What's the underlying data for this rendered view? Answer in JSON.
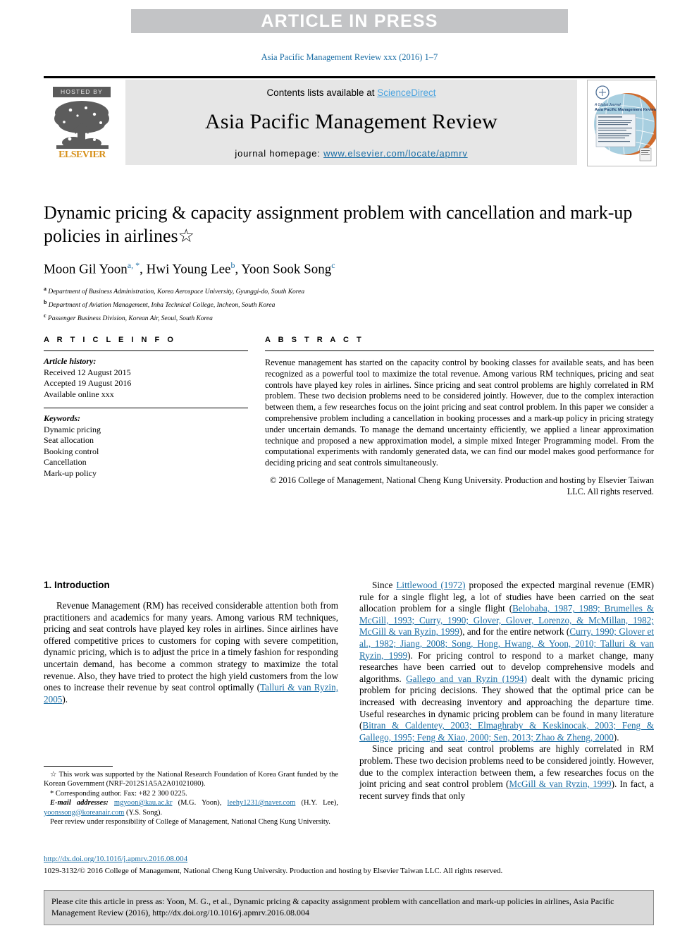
{
  "banner": {
    "text": "ARTICLE IN PRESS"
  },
  "running_head": "Asia Pacific Management Review xxx (2016) 1–7",
  "masthead": {
    "hosted_by": "HOSTED BY",
    "publisher": "ELSEVIER",
    "contents_prefix": "Contents lists available at ",
    "contents_link": "ScienceDirect",
    "journal_title": "Asia Pacific Management Review",
    "homepage_label": "journal homepage: ",
    "homepage_url": "www.elsevier.com/locate/apmrv",
    "cover_line1": "A Global Journal",
    "cover_line2": "Asia Pacific Management Review"
  },
  "article": {
    "title": "Dynamic pricing & capacity assignment problem with cancellation and mark-up policies in airlines☆",
    "authors": "Moon Gil Yoon a,*, Hwi Young Lee b, Yoon Sook Song c",
    "affiliations": [
      "a Department of Business Administration, Korea Aerospace University, Gyunggi-do, South Korea",
      "b Department of Aviation Management, Inha Technical College, Incheon, South Korea",
      "c Passenger Business Division, Korean Air, Seoul, South Korea"
    ]
  },
  "article_info": {
    "heading": "A R T I C L E   I N F O",
    "history_label": "Article history:",
    "history": [
      "Received 12 August 2015",
      "Accepted 19 August 2016",
      "Available online xxx"
    ],
    "keywords_label": "Keywords:",
    "keywords": [
      "Dynamic pricing",
      "Seat allocation",
      "Booking control",
      "Cancellation",
      "Mark-up policy"
    ]
  },
  "abstract": {
    "heading": "A B S T R A C T",
    "text": "Revenue management has started on the capacity control by booking classes for available seats, and has been recognized as a powerful tool to maximize the total revenue. Among various RM techniques, pricing and seat controls have played key roles in airlines. Since pricing and seat control problems are highly correlated in RM problem. These two decision problems need to be considered jointly. However, due to the complex interaction between them, a few researches focus on the joint pricing and seat control problem. In this paper we consider a comprehensive problem including a cancellation in booking processes and a mark-up policy in pricing strategy under uncertain demands. To manage the demand uncertainty efficiently, we applied a linear approximation technique and proposed a new approximation model, a simple mixed Integer Programming model. From the computational experiments with randomly generated data, we can find our model makes good performance for deciding pricing and seat controls simultaneously.",
    "copyright": "© 2016 College of Management, National Cheng Kung University. Production and hosting by Elsevier Taiwan LLC. All rights reserved."
  },
  "introduction": {
    "heading": "1. Introduction",
    "left_paragraph": "Revenue Management (RM) has received considerable attention both from practitioners and academics for many years. Among various RM techniques, pricing and seat controls have played key roles in airlines. Since airlines have offered competitive prices to customers for coping with severe competition, dynamic pricing, which is to adjust the price in a timely fashion for responding uncertain demand, has become a common strategy to maximize the total revenue. Also, they have tried to protect the high yield customers from the low ones to increase their revenue by seat control optimally (",
    "left_ref": "Talluri & van Ryzin, 2005",
    "left_tail": ").",
    "right_p1_a": "Since ",
    "right_p1_ref1": "Littlewood (1972)",
    "right_p1_b": " proposed the expected marginal revenue (EMR) rule for a single flight leg, a lot of studies have been carried on the seat allocation problem for a single flight (",
    "right_p1_ref2": "Belobaba, 1987, 1989; Brumelles & McGill, 1993; Curry, 1990; Glover, Glover, Lorenzo, & McMillan, 1982; McGill & van Ryzin, 1999",
    "right_p1_c": "), and for the entire network (",
    "right_p1_ref3": "Curry, 1990; Glover et al., 1982; Jiang, 2008; Song, Hong, Hwang, & Yoon, 2010; Talluri & van Ryzin, 1999",
    "right_p1_d": "). For pricing control to respond to a market change, many researches have been carried out to develop comprehensive models and algorithms. ",
    "right_p1_ref4": "Gallego and van Ryzin (1994)",
    "right_p1_e": " dealt with the dynamic pricing problem for pricing decisions. They showed that the optimal price can be increased with decreasing inventory and approaching the departure time. Useful researches in dynamic pricing problem can be found in many literature (",
    "right_p1_ref5": "Bitran & Caldentey, 2003; Elmaghraby & Keskinocak, 2003; Feng & Gallego, 1995; Feng & Xiao, 2000; Sen, 2013; Zhao & Zheng, 2000",
    "right_p1_f": ").",
    "right_p2_a": "Since pricing and seat control problems are highly correlated in RM problem. These two decision problems need to be considered jointly. However, due to the complex interaction between them, a few researches focus on the joint pricing and seat control problem (",
    "right_p2_ref1": "McGill & van Ryzin, 1999",
    "right_p2_b": "). In fact, a recent survey finds that only"
  },
  "footnotes": {
    "star_a": "☆ This work was supported by the National Research Foundation of Korea Grant funded by the Korean Government (NRF-2012S1A5A2A01021080).",
    "star_b": "* Corresponding author. Fax: +82 2 300 0225.",
    "email_label": "E-mail addresses:",
    "email1": "mgyoon@kau.ac.kr",
    "email1_owner": " (M.G. Yoon), ",
    "email2": "leehy1231@naver.com",
    "email2_owner": " (H.Y. Lee), ",
    "email3": "yoonssong@koreanair.com",
    "email3_owner": " (Y.S. Song).",
    "peer_review": "Peer review under responsibility of College of Management, National Cheng Kung University."
  },
  "doi_block": {
    "doi_url": "http://dx.doi.org/10.1016/j.apmrv.2016.08.004",
    "issn_line": "1029-3132/© 2016 College of Management, National Cheng Kung University. Production and hosting by Elsevier Taiwan LLC. All rights reserved."
  },
  "cite_box": {
    "text": "Please cite this article in press as: Yoon, M. G., et al., Dynamic pricing & capacity assignment problem with cancellation and mark-up policies in airlines, Asia Pacific Management Review (2016), http://dx.doi.org/10.1016/j.apmrv.2016.08.004"
  },
  "colors": {
    "link": "#1b6ea5",
    "banner_bg": "#c3c4c6",
    "masthead_bg": "#e6e6e6",
    "elsevier_orange": "#d79019"
  }
}
